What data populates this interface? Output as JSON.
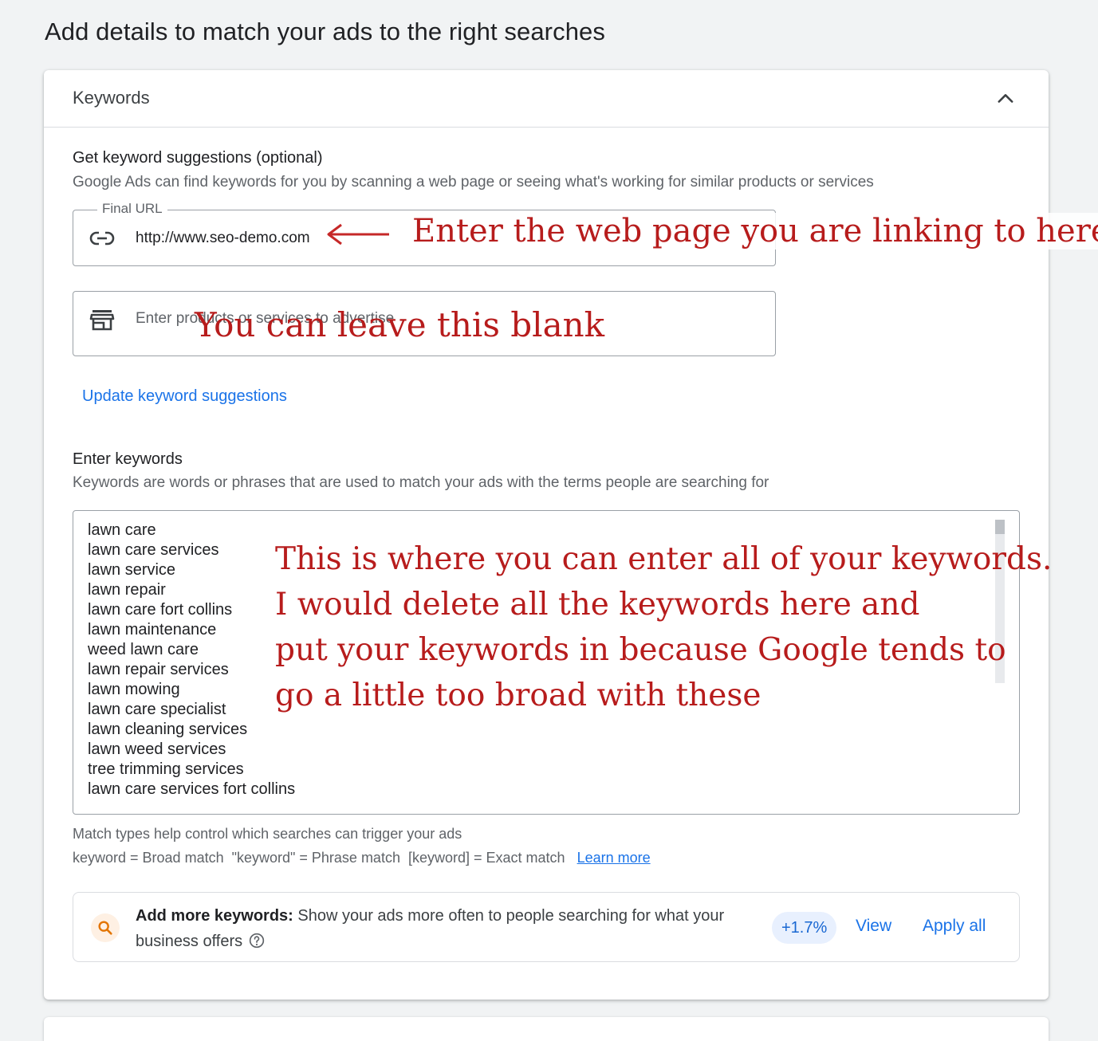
{
  "page": {
    "title": "Add details to match your ads to the right searches"
  },
  "keywords_card": {
    "title": "Keywords",
    "suggestions": {
      "title": "Get keyword suggestions (optional)",
      "description": "Google Ads can find keywords for you by scanning a web page or seeing what's working for similar products or services",
      "final_url_label": "Final URL",
      "final_url_value": "http://www.seo-demo.com",
      "products_placeholder": "Enter products or services to advertise",
      "update_link": "Update keyword suggestions"
    },
    "enter_keywords": {
      "title": "Enter keywords",
      "description": "Keywords are words or phrases that are used to match your ads with the terms people are searching for",
      "keywords": [
        "lawn care",
        "lawn care services",
        "lawn service",
        "lawn repair",
        "lawn care fort collins",
        "lawn maintenance",
        "weed lawn care",
        "lawn repair services",
        "lawn mowing",
        "lawn care specialist",
        "lawn cleaning services",
        "lawn weed services",
        "tree trimming services",
        "lawn care services fort collins"
      ]
    },
    "match_types": {
      "line1": "Match types help control which searches can trigger your ads",
      "line2": "keyword = Broad match  \"keyword\" = Phrase match  [keyword] = Exact match",
      "learn_more": "Learn more"
    },
    "add_more": {
      "bold": "Add more keywords:",
      "text": " Show your ads more often to people searching for what your business offers",
      "badge": "+1.7%",
      "view": "View",
      "apply_all": "Apply all"
    }
  },
  "annotations": {
    "url_note": "Enter the web page you are linking to here",
    "blank_note": "You can leave this blank",
    "keywords_note": [
      "This is where you can enter all of your keywords.",
      "I would delete all the keywords here and",
      "put your keywords in because Google tends to",
      "go a little too broad with these"
    ],
    "color": "#b71c1c"
  }
}
